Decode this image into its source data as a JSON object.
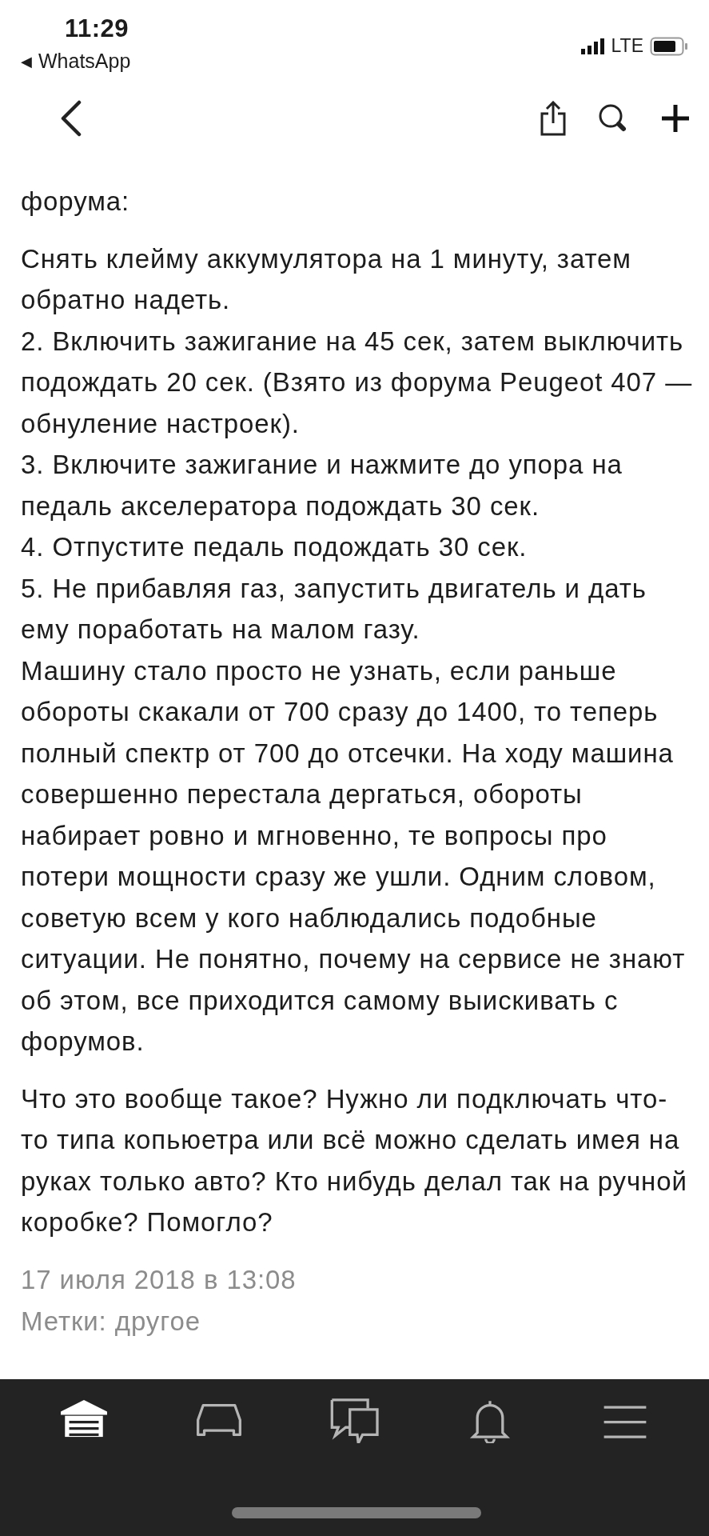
{
  "status_bar": {
    "time": "11:29",
    "back_arrow": "◀",
    "back_app": "WhatsApp",
    "network": "LTE"
  },
  "nav_bar": {
    "actions": [
      {
        "kind": "share"
      },
      {
        "kind": "search"
      },
      {
        "kind": "add"
      }
    ]
  },
  "post": {
    "paragraphs": [
      [
        "форума:"
      ],
      [
        "Снять клейму аккумулятора на 1 минуту, затем обратно надеть.",
        "2. Включить зажигание на 45 сек, затем выключить подождать 20 сек. (Взято из форума Peugeot 407 — обнуление настроек).",
        "3. Включите зажигание и нажмите до упора на педаль акселератора подождать 30 сек.",
        "4. Отпустите педаль подождать 30 сек.",
        "5. Не прибавляя газ, запустить двигатель и дать ему поработать на малом газу.",
        "Машину стало просто не узнать, если раньше обороты скакали от 700 сразу до 1400, то теперь полный спектр от 700 до отсечки. На ходу машина совершенно перестала дергаться, обороты набирает ровно и мгновенно, те вопросы про потери мощности сразу же ушли. Одним словом, советую всем у кого наблюдались подобные ситуации. Не понятно, почему на сервисе не знают об этом, все приходится самому выискивать с форумов."
      ],
      [
        "Что это вообще такое? Нужно ли подключать что-то типа копьюетра или всё можно сделать имея на руках только авто? Кто нибудь делал так на ручной коробке? Помогло?"
      ]
    ],
    "date": "17 июля 2018 в 13:08",
    "tags": "Метки: другое"
  },
  "tab_bar": [
    {
      "kind": "garage",
      "selected": true
    },
    {
      "kind": "car",
      "selected": false
    },
    {
      "kind": "chat",
      "selected": false
    },
    {
      "kind": "bell",
      "selected": false
    },
    {
      "kind": "menu",
      "selected": false
    }
  ]
}
